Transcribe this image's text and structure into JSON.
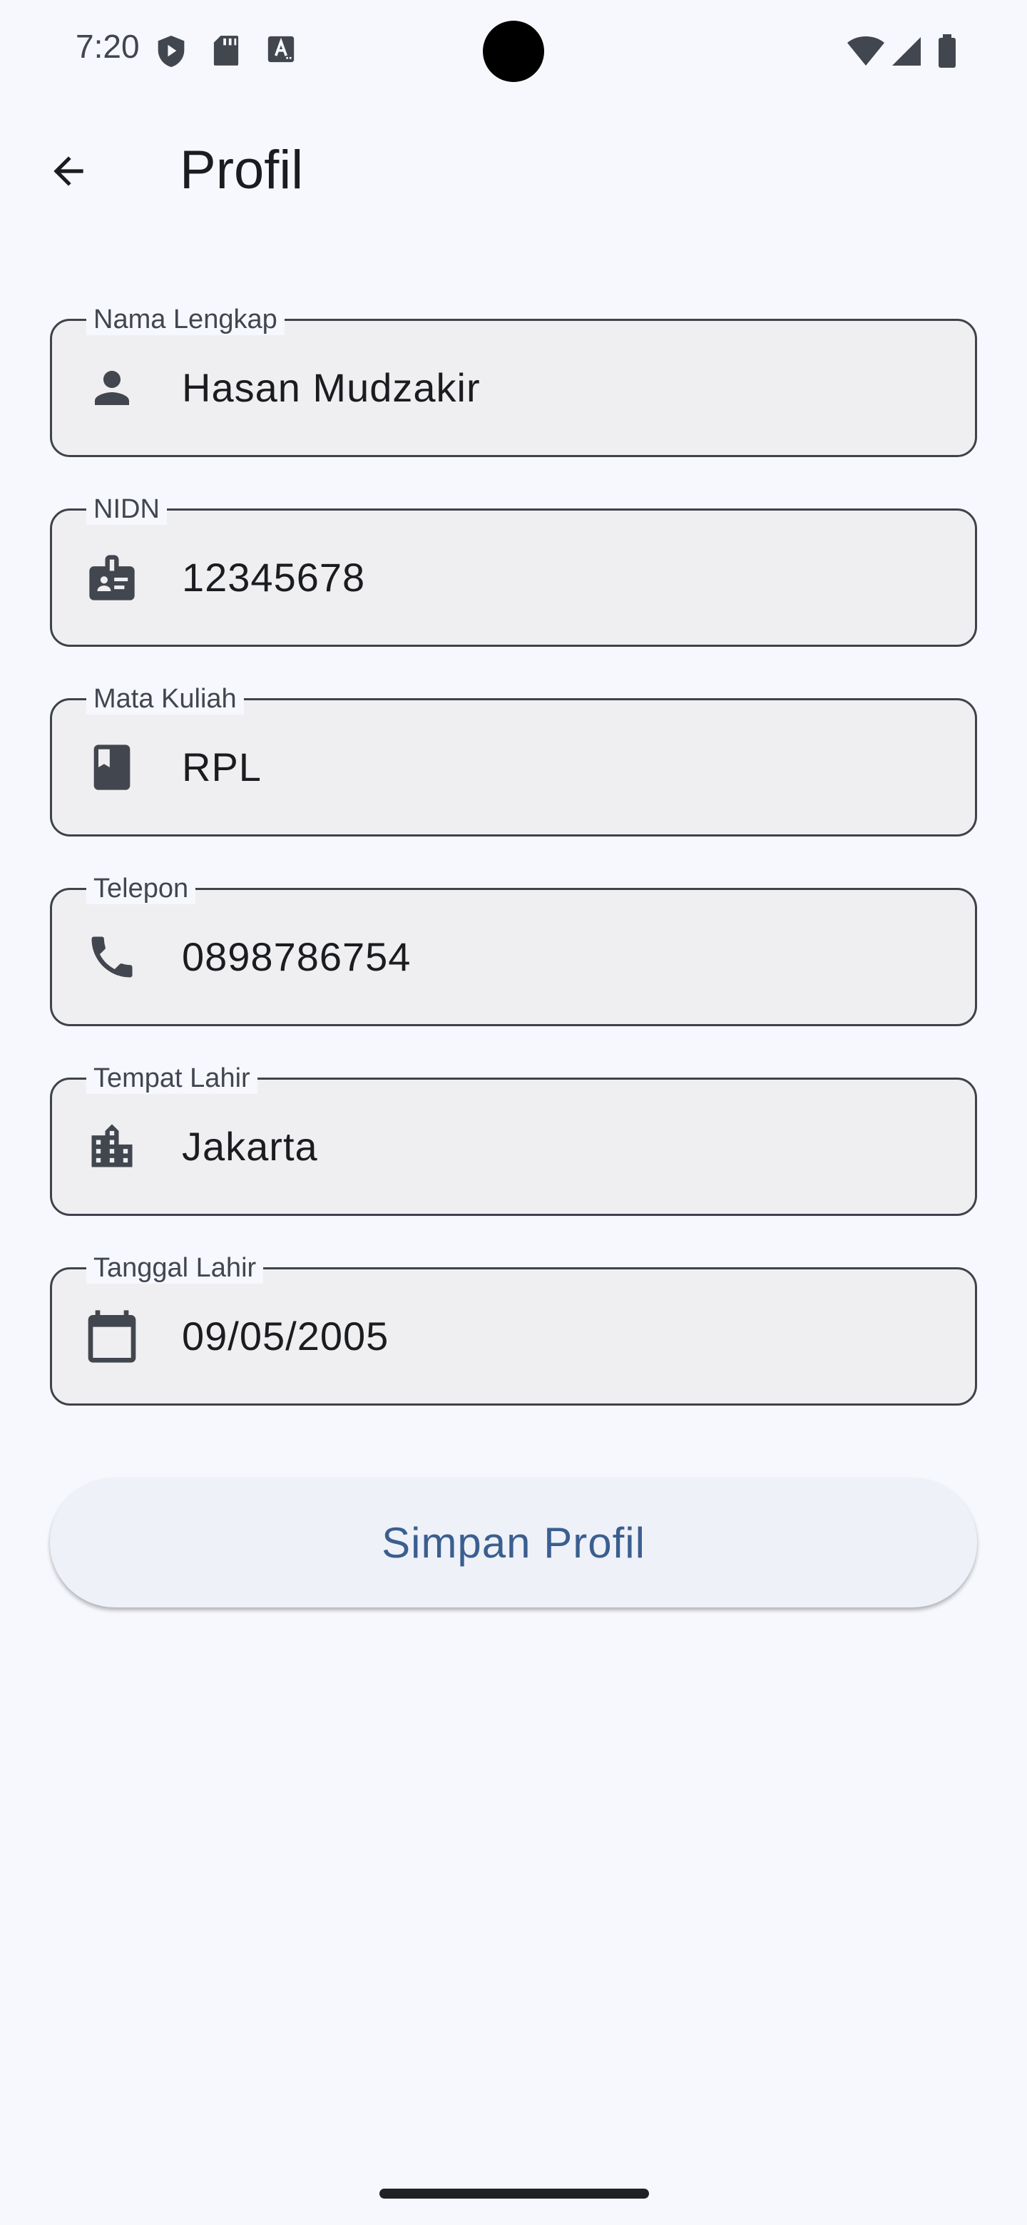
{
  "status_bar": {
    "time": "7:20",
    "left_icons": [
      "shield-play-icon",
      "sd-card-icon",
      "keyboard-a-icon"
    ],
    "right_icons": [
      "wifi-icon",
      "cellular-signal-icon",
      "battery-icon"
    ]
  },
  "app_bar": {
    "back_icon": "arrow-back-icon",
    "title": "Profil"
  },
  "form": {
    "fields": [
      {
        "label": "Nama Lengkap",
        "value": "Hasan Mudzakir",
        "icon": "person-icon"
      },
      {
        "label": "NIDN",
        "value": "12345678",
        "icon": "badge-icon"
      },
      {
        "label": "Mata Kuliah",
        "value": "RPL",
        "icon": "book-icon"
      },
      {
        "label": "Telepon",
        "value": "0898786754",
        "icon": "phone-icon"
      },
      {
        "label": "Tempat Lahir",
        "value": "Jakarta",
        "icon": "location-city-icon"
      },
      {
        "label": "Tanggal Lahir",
        "value": "09/05/2005",
        "icon": "calendar-icon"
      }
    ],
    "save_label": "Simpan Profil"
  },
  "colors": {
    "background": "#f7f8fd",
    "field_fill": "#efeff1",
    "field_border": "#3f424a",
    "button_bg": "#eff1f9",
    "button_text": "#3a5f8f",
    "icon": "#42464e"
  }
}
